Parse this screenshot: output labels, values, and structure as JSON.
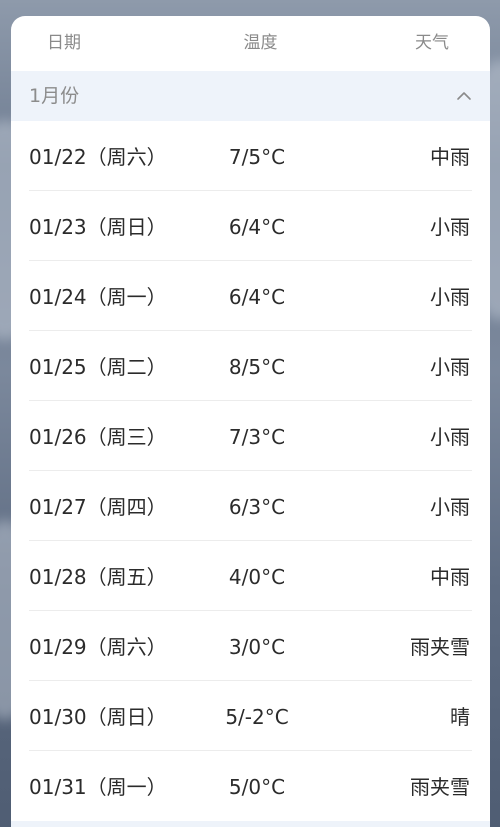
{
  "header": {
    "date_label": "日期",
    "temp_label": "温度",
    "weather_label": "天气"
  },
  "month": {
    "label": "1月份",
    "toggle_icon": "chevron-up-icon"
  },
  "rows": [
    {
      "date": "01/22（周六）",
      "temp": "7/5°C",
      "weather": "中雨"
    },
    {
      "date": "01/23（周日）",
      "temp": "6/4°C",
      "weather": "小雨"
    },
    {
      "date": "01/24（周一）",
      "temp": "6/4°C",
      "weather": "小雨"
    },
    {
      "date": "01/25（周二）",
      "temp": "8/5°C",
      "weather": "小雨"
    },
    {
      "date": "01/26（周三）",
      "temp": "7/3°C",
      "weather": "小雨"
    },
    {
      "date": "01/27（周四）",
      "temp": "6/3°C",
      "weather": "小雨"
    },
    {
      "date": "01/28（周五）",
      "temp": "4/0°C",
      "weather": "中雨"
    },
    {
      "date": "01/29（周六）",
      "temp": "3/0°C",
      "weather": "雨夹雪"
    },
    {
      "date": "01/30（周日）",
      "temp": "5/-2°C",
      "weather": "晴"
    },
    {
      "date": "01/31（周一）",
      "temp": "5/0°C",
      "weather": "雨夹雪"
    }
  ]
}
